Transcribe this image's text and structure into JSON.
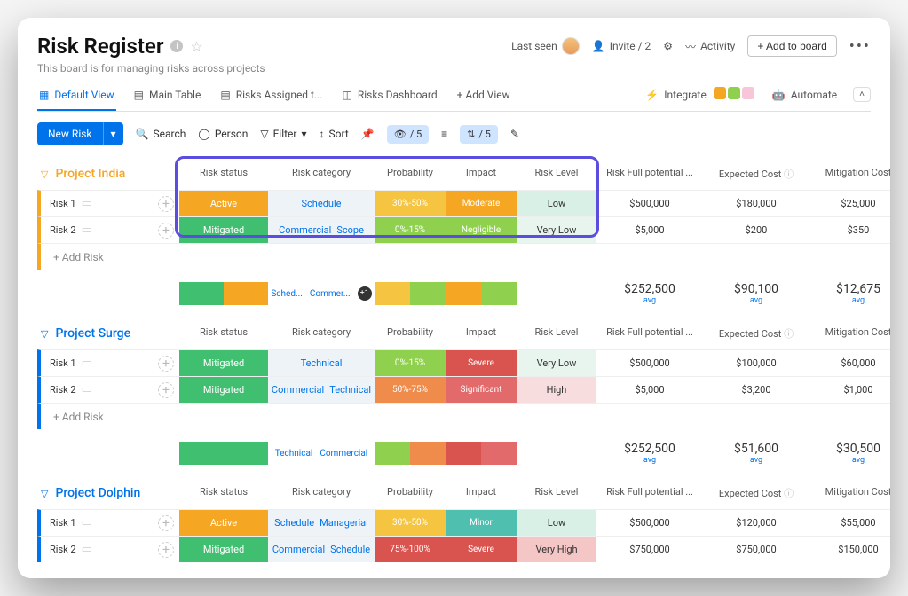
{
  "header": {
    "title": "Risk Register",
    "subtitle": "This board is for managing risks across projects",
    "last_seen": "Last seen",
    "invite": "Invite / 2",
    "activity": "Activity",
    "add_to_board": "+ Add to board"
  },
  "views": {
    "items": [
      "Default View",
      "Main Table",
      "Risks Assigned t...",
      "Risks Dashboard"
    ],
    "add": "+ Add View",
    "integrate": "Integrate",
    "automate": "Automate"
  },
  "toolbar": {
    "new_risk": "New Risk",
    "search": "Search",
    "person": "Person",
    "filter": "Filter",
    "sort": "Sort",
    "eye": "/ 5",
    "height": "/ 5"
  },
  "columns": [
    "Risk status",
    "Risk category",
    "Probability",
    "Impact",
    "Risk Level",
    "Risk Full potential ...",
    "Expected Cost",
    "Mitigation Cost"
  ],
  "groups": [
    {
      "name": "Project India",
      "color": "#f5a623",
      "rows": [
        {
          "name": "Risk 1",
          "status": "Active",
          "status_color": "#f5a623",
          "cats": [
            "Schedule"
          ],
          "prob": "30%-50%",
          "prob_color": "#f5c542",
          "impact": "Moderate",
          "impact_color": "#f5a623",
          "risk": "Low",
          "risk_bg": "#d9f0e6",
          "full": "$500,000",
          "exp": "$180,000",
          "mit": "$25,000"
        },
        {
          "name": "Risk 2",
          "status": "Mitigated",
          "status_color": "#3fbf6f",
          "cats": [
            "Commercial",
            "Scope"
          ],
          "prob": "0%-15%",
          "prob_color": "#8fd14f",
          "impact": "Negligible",
          "impact_color": "#8fd14f",
          "risk": "Very Low",
          "risk_bg": "#e8f5ee",
          "full": "$5,000",
          "exp": "$200",
          "mit": "$350"
        }
      ],
      "add": "+ Add Risk",
      "summary": {
        "status_segments": [
          [
            "#3fbf6f",
            50
          ],
          [
            "#f5a623",
            50
          ]
        ],
        "cat_tags": [
          "Sched...",
          "Commer..."
        ],
        "more": "+1",
        "prob_segments": [
          [
            "#f5c542",
            50
          ],
          [
            "#8fd14f",
            50
          ]
        ],
        "impact_segments": [
          [
            "#f5a623",
            50
          ],
          [
            "#8fd14f",
            50
          ]
        ],
        "full": "$252,500",
        "exp": "$90,100",
        "mit": "$12,675"
      }
    },
    {
      "name": "Project Surge",
      "color": "#0073ea",
      "rows": [
        {
          "name": "Risk 1",
          "status": "Mitigated",
          "status_color": "#3fbf6f",
          "cats": [
            "Technical"
          ],
          "prob": "0%-15%",
          "prob_color": "#8fd14f",
          "impact": "Severe",
          "impact_color": "#d9534f",
          "risk": "Very Low",
          "risk_bg": "#e8f5ee",
          "full": "$500,000",
          "exp": "$100,000",
          "mit": "$60,000"
        },
        {
          "name": "Risk 2",
          "status": "Mitigated",
          "status_color": "#3fbf6f",
          "cats": [
            "Commercial",
            "Technical"
          ],
          "prob": "50%-75%",
          "prob_color": "#f08c4b",
          "impact": "Significant",
          "impact_color": "#e26a6a",
          "risk": "High",
          "risk_bg": "#f7dddd",
          "full": "$5,000",
          "exp": "$3,200",
          "mit": "$1,000"
        }
      ],
      "add": "+ Add Risk",
      "summary": {
        "status_segments": [
          [
            "#3fbf6f",
            100
          ]
        ],
        "cat_tags": [
          "Technical",
          "Commercial"
        ],
        "more": "",
        "prob_segments": [
          [
            "#8fd14f",
            50
          ],
          [
            "#f08c4b",
            50
          ]
        ],
        "impact_segments": [
          [
            "#d9534f",
            50
          ],
          [
            "#e26a6a",
            50
          ]
        ],
        "full": "$252,500",
        "exp": "$51,600",
        "mit": "$30,500"
      }
    },
    {
      "name": "Project Dolphin",
      "color": "#0073ea",
      "rows": [
        {
          "name": "Risk 1",
          "status": "Active",
          "status_color": "#f5a623",
          "cats": [
            "Schedule",
            "Managerial"
          ],
          "prob": "30%-50%",
          "prob_color": "#f5c542",
          "impact": "Minor",
          "impact_color": "#4fc0b0",
          "risk": "Low",
          "risk_bg": "#d9f0e6",
          "full": "$500,000",
          "exp": "$120,000",
          "mit": "$55,000"
        },
        {
          "name": "Risk 2",
          "status": "Mitigated",
          "status_color": "#3fbf6f",
          "cats": [
            "Commercial",
            "Schedule"
          ],
          "prob": "75%-100%",
          "prob_color": "#d9534f",
          "impact": "Severe",
          "impact_color": "#d9534f",
          "risk": "Very High",
          "risk_bg": "#f5c6c6",
          "full": "$750,000",
          "exp": "$750,000",
          "mit": "$150,000"
        }
      ]
    }
  ],
  "avg_label": "avg"
}
